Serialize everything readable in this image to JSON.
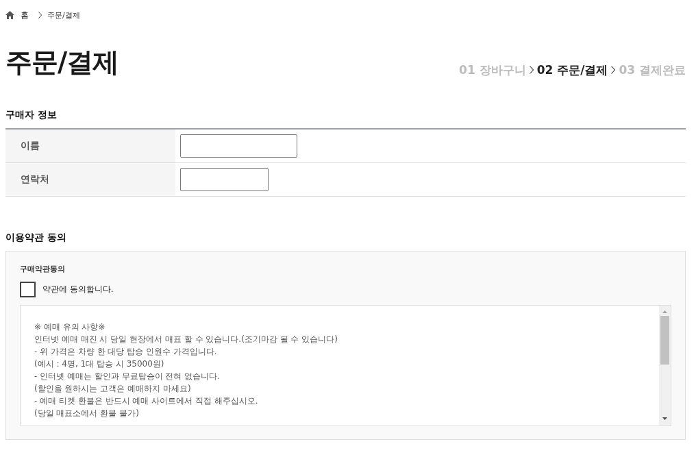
{
  "breadcrumb": {
    "home": "홈",
    "current": "주문/결제"
  },
  "page_title": "주문/결제",
  "steps": [
    {
      "label": "01 장바구니",
      "selected": false
    },
    {
      "label": "02 주문/결제",
      "selected": true
    },
    {
      "label": "03 결제완료",
      "selected": false
    }
  ],
  "buyer_info": {
    "title": "구매자 정보",
    "fields": [
      {
        "label": "이름",
        "kind": "name"
      },
      {
        "label": "연락처",
        "kind": "phone"
      }
    ]
  },
  "terms": {
    "title": "이용약관 동의",
    "subtitle": "구매약관동의",
    "agree": {
      "label": "약관에 동의합니다.",
      "checked": false
    },
    "content": [
      "※ 예매 유의 사항※",
      "인터넷 예매 매진 시 당일 현장에서 매표 할 수 있습니다.(조기마감 될 수 있습니다)",
      "- 위 가격은 차량 한 대당 탑승 인원수 가격입니다.",
      "(예시 : 4명, 1대 탑승 시 35000원)",
      "- 인터넷 예매는 할인과 무료탑승이 전혀 없습니다.",
      "(할인을 원하시는 고객은 예매하지 마세요)",
      "- 예매 티켓 환불은 반드시 예매 사이트에서 직접 해주십시오.",
      "(당일 매표소에서 환불 불가)"
    ]
  }
}
